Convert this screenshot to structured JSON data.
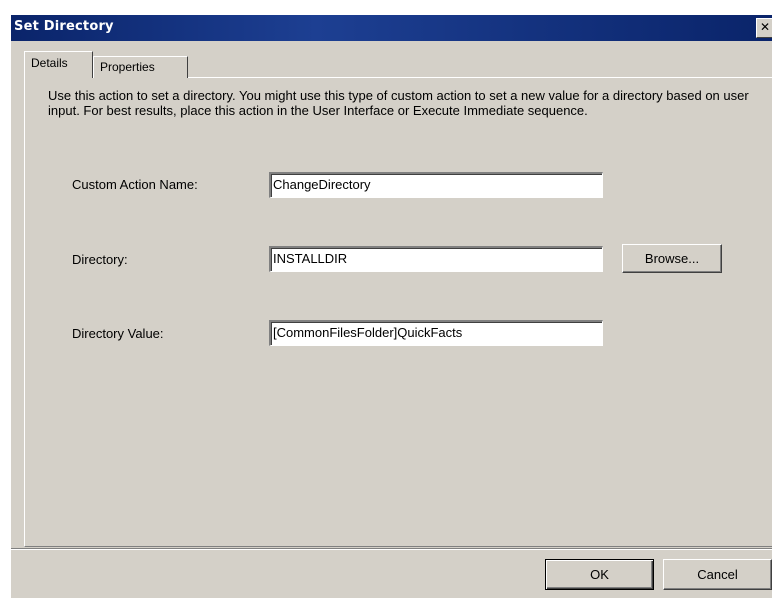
{
  "window": {
    "title": "Set Directory",
    "close_glyph": "✕"
  },
  "tabs": [
    {
      "label": "Details",
      "active": true
    },
    {
      "label": "Properties",
      "active": false
    }
  ],
  "details": {
    "description": "Use this action to set a directory. You might use this type of custom action to set a new value for a directory based on user input. For best results, place this action in the User Interface or Execute Immediate sequence.",
    "custom_action_name": {
      "label": "Custom Action Name:",
      "value": "ChangeDirectory"
    },
    "directory": {
      "label": "Directory:",
      "value": "INSTALLDIR",
      "browse_label": "Browse..."
    },
    "directory_value": {
      "label": "Directory Value:",
      "value": "[CommonFilesFolder]QuickFacts"
    }
  },
  "footer": {
    "ok_label": "OK",
    "cancel_label": "Cancel"
  }
}
